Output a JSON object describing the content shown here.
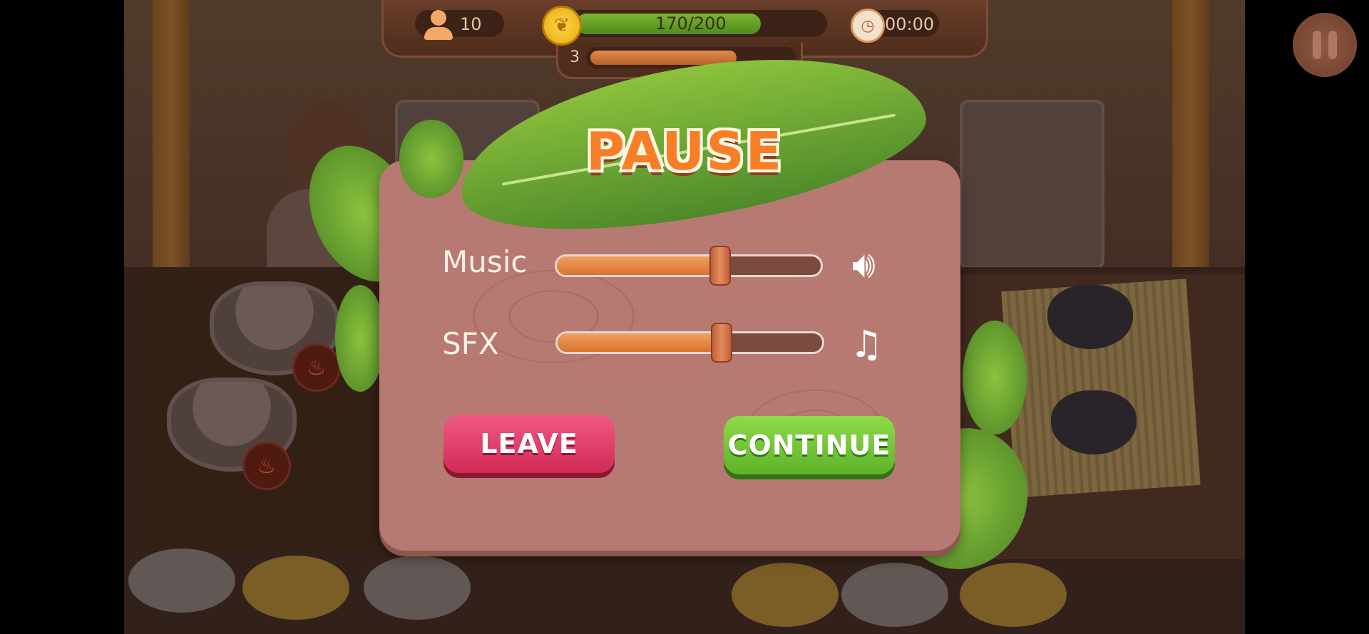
{
  "hud": {
    "customers": "10",
    "coin_progress_text": "170/200",
    "coin_progress_value": 0.85,
    "timer": "00:00",
    "level": "3",
    "level_progress_value": 0.72
  },
  "pause_dialog": {
    "title": "PAUSE",
    "music_label": "Music",
    "music_level": 0.62,
    "sfx_label": "SFX",
    "sfx_level": 0.62,
    "leave_label": "LEAVE",
    "continue_label": "CONTINUE"
  },
  "icons": {
    "music_icon": "speaker-icon",
    "sfx_icon": "music-note-icon",
    "customers_icon": "person-icon",
    "coin_icon": "leaf-coin-icon",
    "timer_icon": "clock-icon",
    "pause_icon": "pause-icon"
  },
  "colors": {
    "title": "#f77e27",
    "leave_button": "#d22a57",
    "continue_button": "#5fb22a",
    "slider_fill": "#d9732f",
    "panel": "#b77a72",
    "progress_fill": "#6aa526"
  }
}
